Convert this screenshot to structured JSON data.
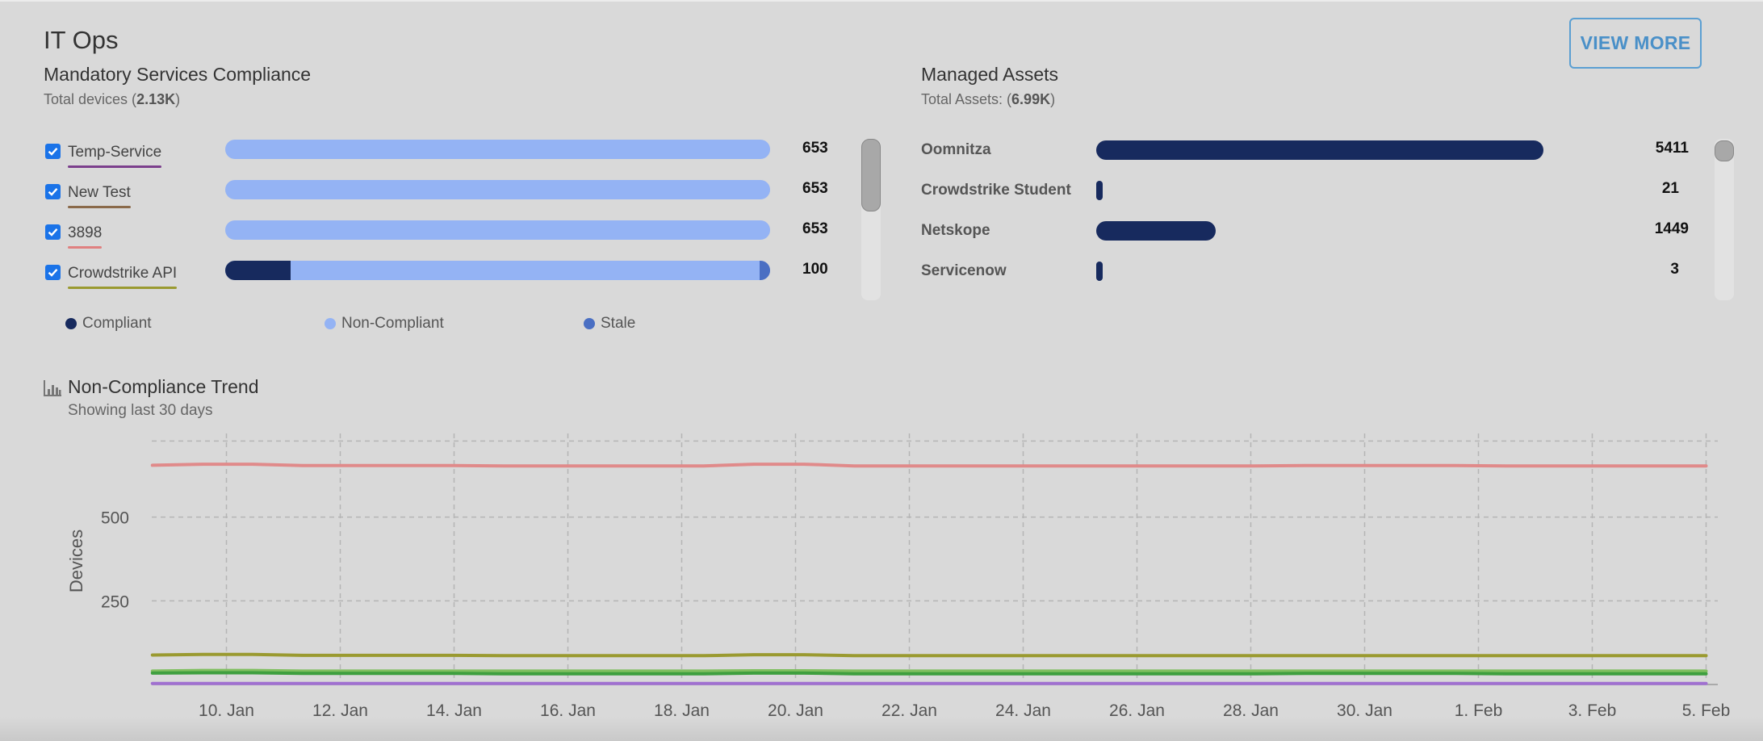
{
  "panel": {
    "title": "IT Ops",
    "view_more_label": "VIEW MORE"
  },
  "compliance": {
    "title": "Mandatory Services Compliance",
    "subtitle_prefix": "Total devices (",
    "subtitle_value": "2.13K",
    "subtitle_suffix": ")",
    "rows": [
      {
        "label": "Temp-Service",
        "value": "653",
        "checked": true,
        "underline_color": "#7b3f8c",
        "compliant_fraction": 0,
        "stale_fraction": 0
      },
      {
        "label": "New Test",
        "value": "653",
        "checked": true,
        "underline_color": "#8a6a4a",
        "compliant_fraction": 0,
        "stale_fraction": 0
      },
      {
        "label": "3898",
        "value": "653",
        "checked": true,
        "underline_color": "#e08080",
        "compliant_fraction": 0,
        "stale_fraction": 0
      },
      {
        "label": "Crowdstrike API",
        "value": "100",
        "checked": true,
        "underline_color": "#9a9a30",
        "compliant_fraction": 0.12,
        "stale_fraction": 0.02
      }
    ],
    "legend": [
      {
        "label": "Compliant",
        "color": "#172a5e"
      },
      {
        "label": "Non-Compliant",
        "color": "#94b3f4"
      },
      {
        "label": "Stale",
        "color": "#4a6fc3"
      }
    ]
  },
  "assets": {
    "title": "Managed Assets",
    "subtitle_prefix": "Total Assets: (",
    "subtitle_value": "6.99K",
    "subtitle_suffix": ")",
    "rows": [
      {
        "label": "Oomnitza",
        "value": "5411",
        "fraction": 0.774
      },
      {
        "label": "Crowdstrike Student",
        "value": "21",
        "fraction": 0.003
      },
      {
        "label": "Netskope",
        "value": "1449",
        "fraction": 0.207
      },
      {
        "label": "Servicenow",
        "value": "3",
        "fraction": 0.0004
      }
    ]
  },
  "trend": {
    "title": "Non-Compliance Trend",
    "subtitle": "Showing last 30 days",
    "icon": "bar-chart-icon"
  },
  "chart_data": {
    "type": "line",
    "ylabel": "Devices",
    "ylim": [
      0,
      750
    ],
    "yticks": [
      250,
      500
    ],
    "ytick_labels": [
      "250",
      "500"
    ],
    "xtick_labels": [
      "10. Jan",
      "12. Jan",
      "14. Jan",
      "16. Jan",
      "18. Jan",
      "20. Jan",
      "22. Jan",
      "24. Jan",
      "26. Jan",
      "28. Jan",
      "30. Jan",
      "1. Feb",
      "3. Feb",
      "5. Feb"
    ],
    "x_start_day": 9,
    "x_end_day": 36,
    "grid": true,
    "series": [
      {
        "color": "#e08a8a",
        "values": [
          655,
          658,
          658,
          654,
          654,
          654,
          654,
          653,
          653,
          653,
          653,
          653,
          658,
          658,
          653,
          653,
          653,
          653,
          653,
          653,
          653,
          653,
          653,
          654,
          654,
          654,
          654,
          653,
          653,
          653,
          653,
          653
        ]
      },
      {
        "color": "#9a9a30",
        "values": [
          88,
          90,
          90,
          87,
          87,
          87,
          87,
          86,
          86,
          86,
          86,
          86,
          89,
          89,
          86,
          86,
          86,
          86,
          86,
          86,
          86,
          86,
          86,
          86,
          86,
          86,
          86,
          86,
          86,
          86,
          86,
          86
        ]
      },
      {
        "color": "#7fbf5f",
        "values": [
          40,
          42,
          42,
          40,
          40,
          40,
          40,
          40,
          40,
          40,
          40,
          40,
          41,
          41,
          40,
          40,
          40,
          40,
          40,
          40,
          40,
          40,
          40,
          40,
          40,
          40,
          40,
          40,
          40,
          40,
          40,
          40
        ]
      },
      {
        "color": "#3f9f3f",
        "values": [
          34,
          35,
          35,
          33,
          33,
          33,
          33,
          32,
          32,
          32,
          32,
          32,
          34,
          34,
          32,
          32,
          32,
          32,
          32,
          32,
          32,
          32,
          32,
          33,
          33,
          33,
          33,
          32,
          32,
          32,
          32,
          32
        ]
      },
      {
        "color": "#a070d0",
        "values": [
          3,
          3,
          3,
          3,
          3,
          3,
          3,
          3,
          3,
          3,
          3,
          3,
          3,
          3,
          3,
          3,
          3,
          3,
          3,
          3,
          3,
          3,
          3,
          3,
          3,
          3,
          3,
          3,
          3,
          3,
          3,
          3
        ]
      }
    ]
  }
}
